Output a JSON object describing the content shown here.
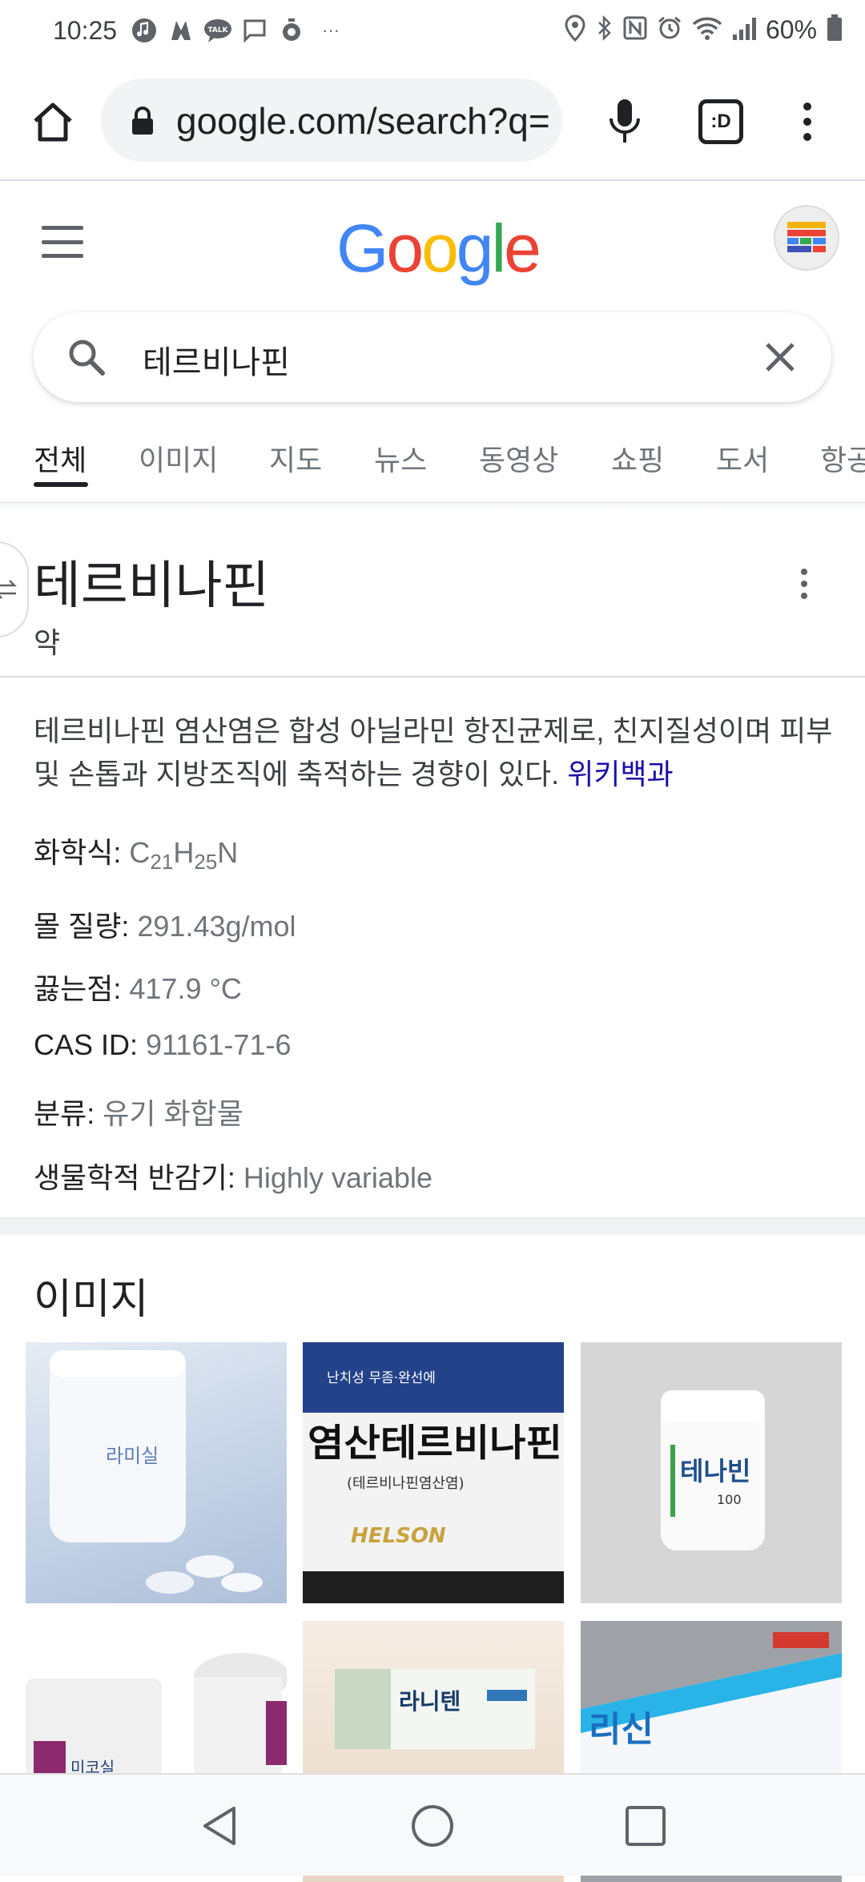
{
  "status_bar": {
    "time": "10:25",
    "left_icons": [
      "music-icon",
      "navigation-app-icon",
      "talk-icon",
      "message-icon",
      "timer-icon"
    ],
    "overflow": "···",
    "right_icons": [
      "location-icon",
      "bluetooth-icon",
      "nfc-icon",
      "alarm-icon",
      "wifi-icon",
      "signal-icon"
    ],
    "battery_percent": "60%"
  },
  "browser": {
    "url": "google.com/search?q=",
    "tabs_count_label": ":D"
  },
  "google": {
    "logo_letters": [
      "G",
      "o",
      "o",
      "g",
      "l",
      "e"
    ],
    "logo_colors": [
      "#4285F4",
      "#EA4335",
      "#FBBC05",
      "#4285F4",
      "#34A853",
      "#EA4335"
    ]
  },
  "search": {
    "query": "테르비나핀"
  },
  "tabs": [
    {
      "label": "전체",
      "active": true
    },
    {
      "label": "이미지"
    },
    {
      "label": "지도"
    },
    {
      "label": "뉴스"
    },
    {
      "label": "동영상"
    },
    {
      "label": "쇼핑"
    },
    {
      "label": "도서"
    },
    {
      "label": "항공"
    }
  ],
  "knowledge_panel": {
    "title": "테르비나핀",
    "subtitle": "약",
    "description": "테르비나핀 염산염은 합성 아닐라민 항진균제로, 친지질성이며 피부 및 손톱과 지방조직에 축적하는 경향이 있다.",
    "source_link": "위키백과",
    "facts": {
      "formula_label": "화학식",
      "formula": {
        "c": "C",
        "c_sub": "21",
        "h": "H",
        "h_sub": "25",
        "n": "N"
      },
      "molar_mass_label": "몰 질량",
      "molar_mass": "291.43g/mol",
      "boiling_point_label": "끓는점",
      "boiling_point": "417.9 °C",
      "cas_label": "CAS ID",
      "cas": "91161-71-6",
      "category_label": "분류",
      "category": "유기 화합물",
      "half_life_label": "생물학적 반감기",
      "half_life": "Highly variable"
    }
  },
  "images_section": {
    "title": "이미지",
    "thumb_texts": {
      "t1": "라미실",
      "t2_top": "난치성 무좀·완선에",
      "t2_main": "염산테르비나핀",
      "t2_sub": "(테르비나핀염산염)",
      "t2_brand": "HELSON",
      "t3": "테나빈",
      "t3_num": "100",
      "t4": "미코실",
      "t5": "라니텐",
      "t6": "리신"
    }
  },
  "nav": {
    "buttons": [
      "back-icon",
      "home-icon",
      "recents-icon"
    ]
  }
}
